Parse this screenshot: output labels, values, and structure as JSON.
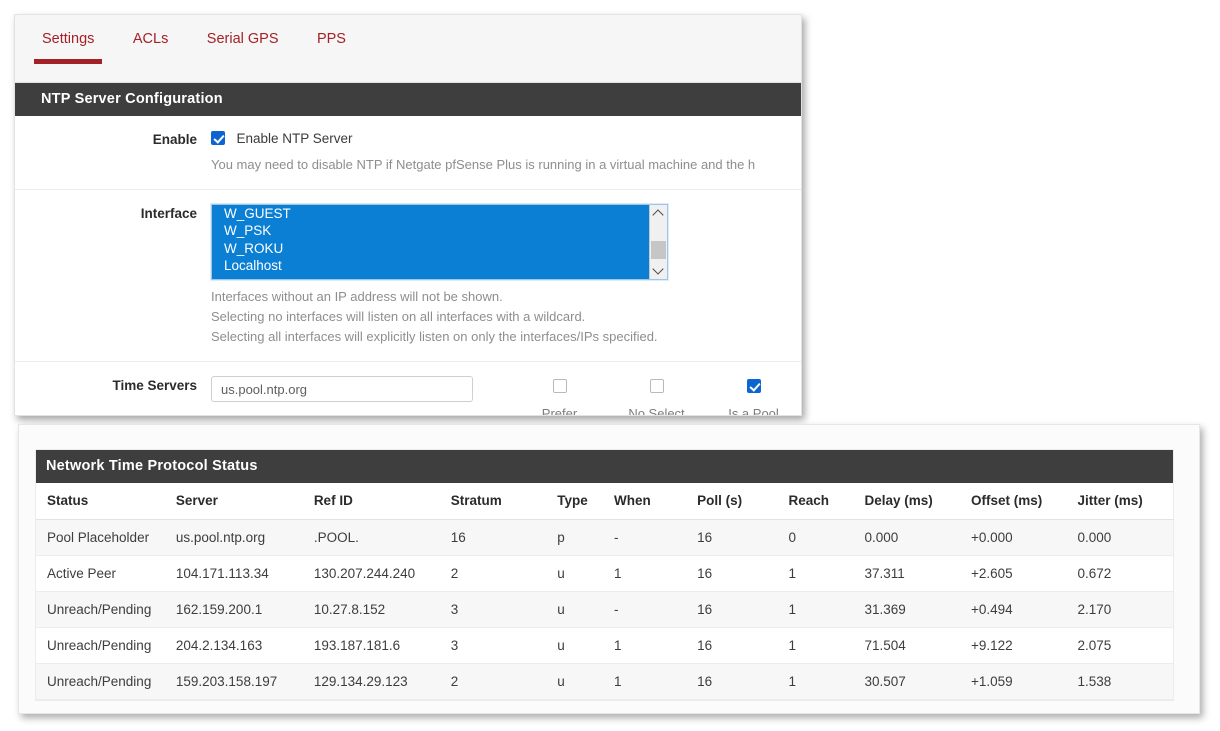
{
  "tabs": [
    {
      "label": "Settings",
      "active": true
    },
    {
      "label": "ACLs",
      "active": false
    },
    {
      "label": "Serial GPS",
      "active": false
    },
    {
      "label": "PPS",
      "active": false
    }
  ],
  "config_panel": {
    "title": "NTP Server Configuration",
    "enable": {
      "label": "Enable",
      "checkbox_label": "Enable NTP Server",
      "checked": true,
      "help": "You may need to disable NTP if Netgate pfSense Plus is running in a virtual machine and the h"
    },
    "interface": {
      "label": "Interface",
      "options": [
        "W_GUEST",
        "W_PSK",
        "W_ROKU",
        "Localhost"
      ],
      "help_lines": [
        "Interfaces without an IP address will not be shown.",
        "Selecting no interfaces will listen on all interfaces with a wildcard.",
        "Selecting all interfaces will explicitly listen on only the interfaces/IPs specified."
      ]
    },
    "time_servers": {
      "label": "Time Servers",
      "value": "us.pool.ntp.org",
      "placeholder": "us.pool.ntp.org",
      "options": [
        {
          "name": "Prefer",
          "checked": false
        },
        {
          "name": "No Select",
          "checked": false
        },
        {
          "name": "Is a Pool",
          "checked": true
        }
      ]
    }
  },
  "status_panel": {
    "title": "Network Time Protocol Status",
    "columns": [
      "Status",
      "Server",
      "Ref ID",
      "Stratum",
      "Type",
      "When",
      "Poll (s)",
      "Reach",
      "Delay (ms)",
      "Offset (ms)",
      "Jitter (ms)"
    ],
    "rows": [
      {
        "status": "Pool Placeholder",
        "server": "us.pool.ntp.org",
        "refid": ".POOL.",
        "stratum": "16",
        "type": "p",
        "when": "-",
        "poll": "16",
        "reach": "0",
        "delay": "0.000",
        "offset": "+0.000",
        "jitter": "0.000"
      },
      {
        "status": "Active Peer",
        "server": "104.171.113.34",
        "refid": "130.207.244.240",
        "stratum": "2",
        "type": "u",
        "when": "1",
        "poll": "16",
        "reach": "1",
        "delay": "37.311",
        "offset": "+2.605",
        "jitter": "0.672"
      },
      {
        "status": "Unreach/Pending",
        "server": "162.159.200.1",
        "refid": "10.27.8.152",
        "stratum": "3",
        "type": "u",
        "when": "-",
        "poll": "16",
        "reach": "1",
        "delay": "31.369",
        "offset": "+0.494",
        "jitter": "2.170"
      },
      {
        "status": "Unreach/Pending",
        "server": "204.2.134.163",
        "refid": "193.187.181.6",
        "stratum": "3",
        "type": "u",
        "when": "1",
        "poll": "16",
        "reach": "1",
        "delay": "71.504",
        "offset": "+9.122",
        "jitter": "2.075"
      },
      {
        "status": "Unreach/Pending",
        "server": "159.203.158.197",
        "refid": "129.134.29.123",
        "stratum": "2",
        "type": "u",
        "when": "1",
        "poll": "16",
        "reach": "1",
        "delay": "30.507",
        "offset": "+1.059",
        "jitter": "1.538"
      }
    ]
  },
  "colors": {
    "tab_accent": "#a32127",
    "panel_header_bg": "#3e3e3e",
    "checkbox_checked": "#0b66d0",
    "listbox_selected_bg": "#0b7fd4",
    "help_text": "#8e8e8e"
  }
}
